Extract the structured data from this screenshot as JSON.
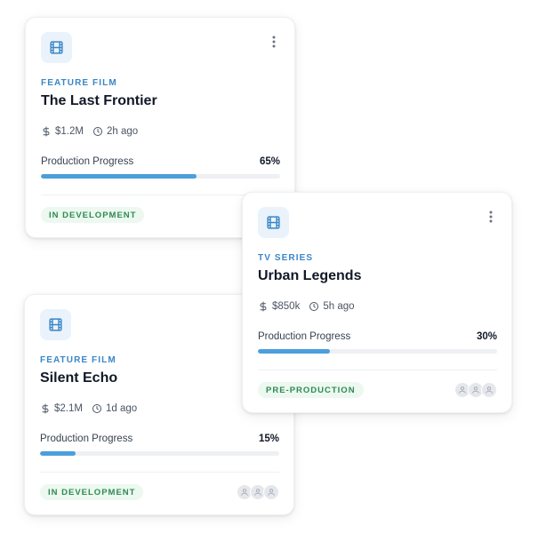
{
  "colors": {
    "accent": "#3a86c8",
    "progress_fill": "#4a9fdc",
    "status_green": "#2f8a52",
    "status_bg": "#ecf8f0"
  },
  "cards": [
    {
      "category": "FEATURE FILM",
      "title": "The Last Frontier",
      "budget": "$1.2M",
      "updated": "2h ago",
      "progress_label": "Production Progress",
      "progress_text": "65%",
      "progress_fraction": 0.65,
      "status": "IN DEVELOPMENT",
      "icons": [
        "film-icon",
        "more-vertical-icon",
        "dollar-icon",
        "clock-icon",
        "user-icon"
      ]
    },
    {
      "category": "TV SERIES",
      "title": "Urban Legends",
      "budget": "$850k",
      "updated": "5h ago",
      "progress_label": "Production Progress",
      "progress_text": "30%",
      "progress_fraction": 0.3,
      "status": "PRE-PRODUCTION",
      "icons": [
        "film-icon",
        "more-vertical-icon",
        "dollar-icon",
        "clock-icon",
        "user-icon"
      ]
    },
    {
      "category": "FEATURE FILM",
      "title": "Silent Echo",
      "budget": "$2.1M",
      "updated": "1d ago",
      "progress_label": "Production Progress",
      "progress_text": "15%",
      "progress_fraction": 0.15,
      "status": "IN DEVELOPMENT",
      "icons": [
        "film-icon",
        "more-vertical-icon",
        "dollar-icon",
        "clock-icon",
        "user-icon"
      ]
    }
  ]
}
